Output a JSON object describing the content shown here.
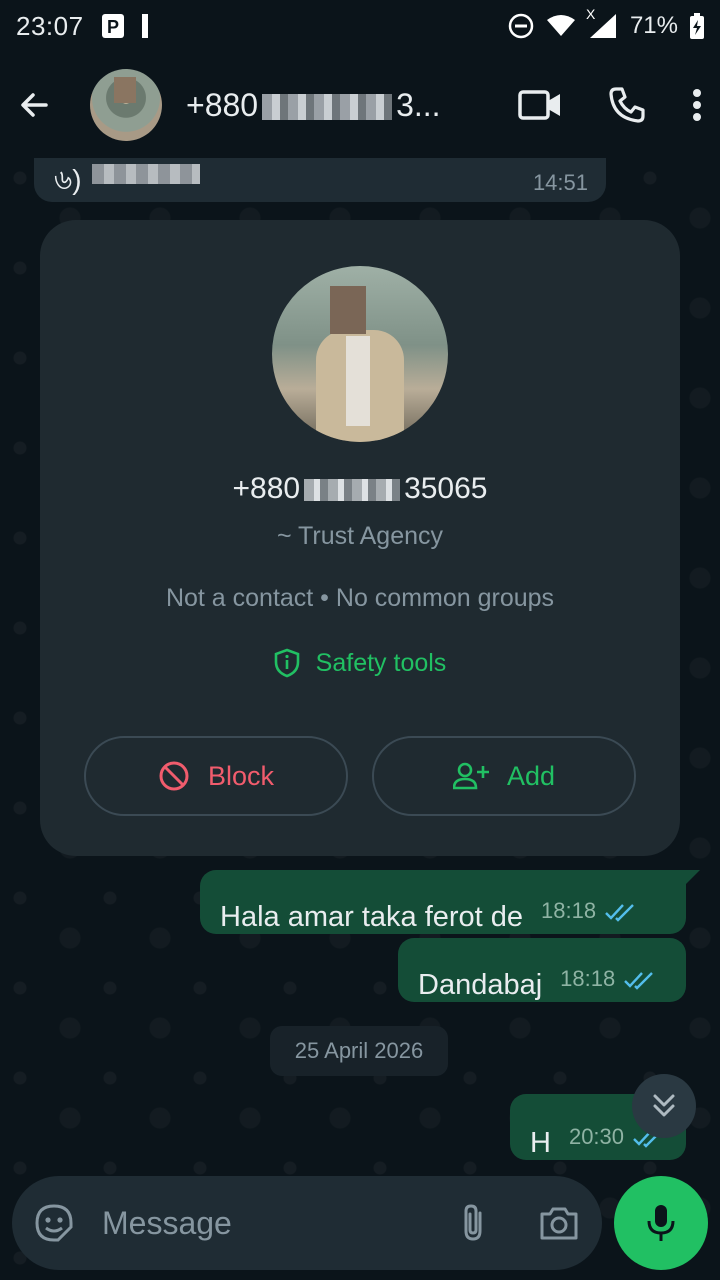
{
  "status_bar": {
    "time": "23:07",
    "battery": "71%",
    "network_indicator": "X"
  },
  "header": {
    "contact_phone_start": "+880",
    "contact_phone_end": "3...",
    "icons": [
      "back-arrow-icon",
      "video-call-icon",
      "voice-call-icon",
      "more-vert-icon"
    ]
  },
  "previous_message": {
    "fragment": "৬)",
    "time": "14:51"
  },
  "contact_card": {
    "phone_start": "+880",
    "phone_end": "35065",
    "agency": "~ Trust Agency",
    "meta": "Not a contact • No common groups",
    "safety_label": "Safety tools",
    "block_label": "Block",
    "add_label": "Add",
    "colors": {
      "block": "#f15c6d",
      "accent": "#21c063"
    }
  },
  "messages": [
    {
      "text": "Hala amar taka ferot de",
      "time": "18:18",
      "status": "read"
    },
    {
      "text": "Dandabaj",
      "time": "18:18",
      "status": "read"
    },
    {
      "text": "H",
      "time": "20:30",
      "status": "read"
    }
  ],
  "date_separator": "25 April 2026",
  "composer": {
    "placeholder": "Message"
  },
  "colors": {
    "background": "#0b141a",
    "outgoing_bubble": "#144d37",
    "read_ticks": "#53bdeb"
  }
}
